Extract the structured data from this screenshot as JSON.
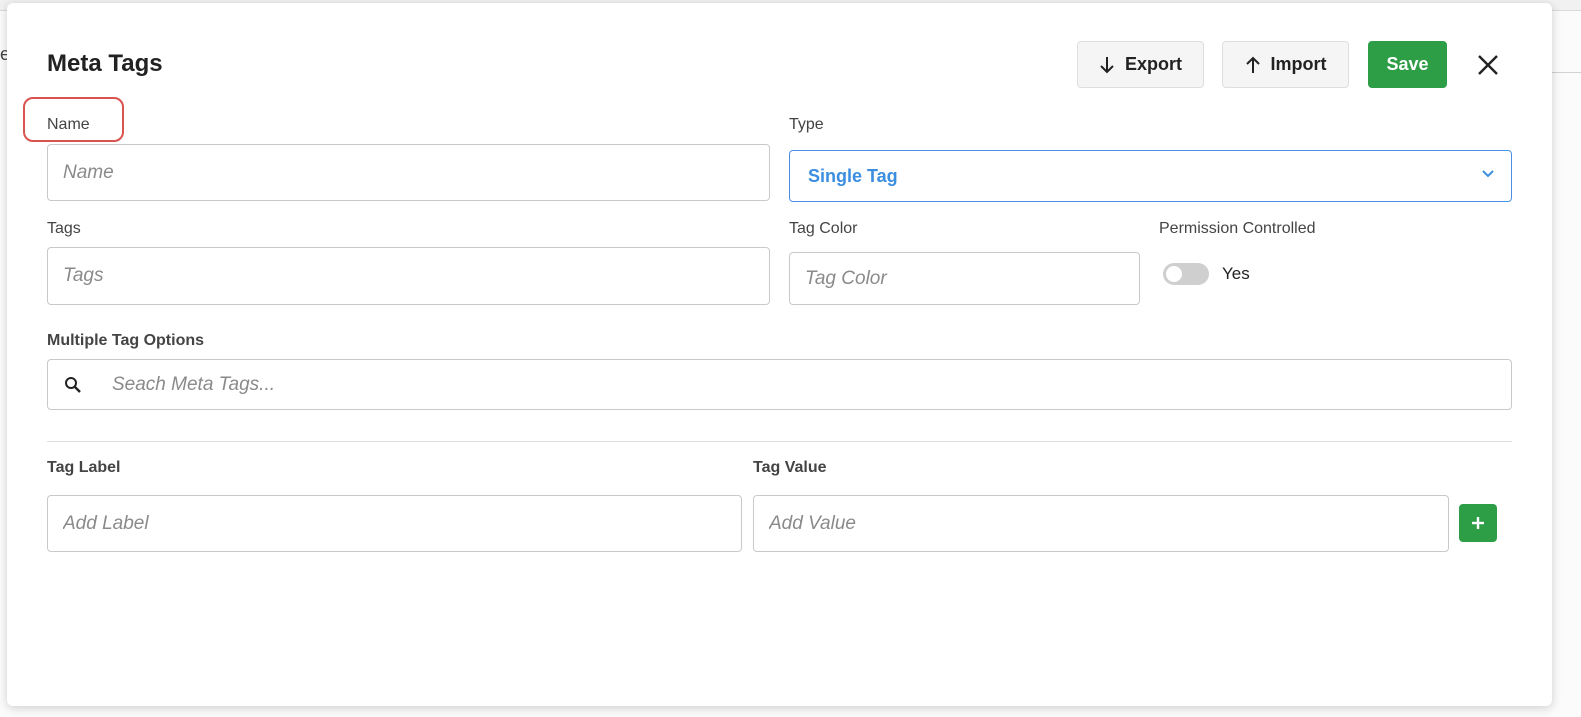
{
  "modal": {
    "title": "Meta Tags"
  },
  "toolbar": {
    "export_label": "Export",
    "import_label": "Import",
    "save_label": "Save"
  },
  "form": {
    "name_label": "Name",
    "name_placeholder": "Name",
    "type_label": "Type",
    "type_value": "Single Tag",
    "tags_label": "Tags",
    "tags_placeholder": "Tags",
    "tag_color_label": "Tag Color",
    "tag_color_placeholder": "Tag Color",
    "permission_label": "Permission Controlled",
    "permission_toggle_text": "Yes",
    "permission_enabled": false,
    "multiple_options_label": "Multiple Tag Options",
    "search_placeholder": "Seach Meta Tags...",
    "tag_label_label": "Tag Label",
    "tag_label_placeholder": "Add Label",
    "tag_value_label": "Tag Value",
    "tag_value_placeholder": "Add Value"
  },
  "colors": {
    "primary_green": "#2e9e46",
    "select_blue": "#3b8ee0",
    "highlight_red": "#d9534f"
  },
  "icons": {
    "export": "arrow-down-icon",
    "import": "arrow-up-icon",
    "close": "close-icon",
    "chevron": "chevron-down-icon",
    "search": "search-icon",
    "add": "plus-icon"
  }
}
